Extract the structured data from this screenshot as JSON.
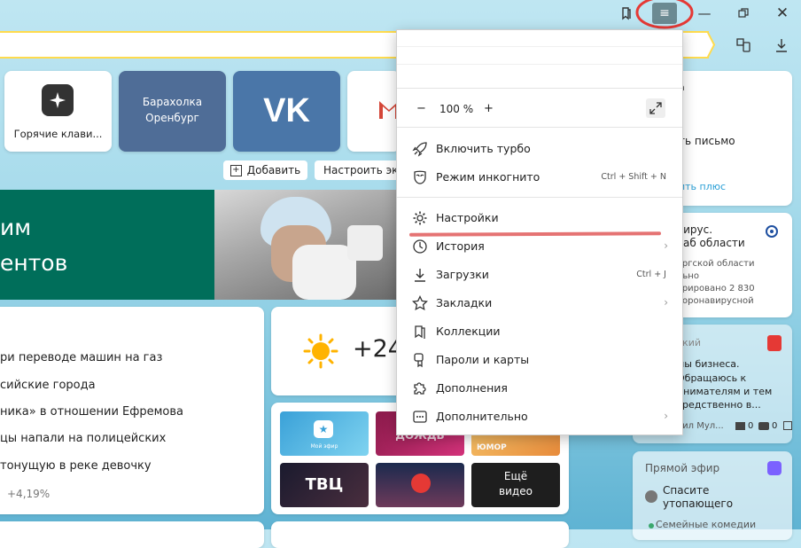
{
  "tiles": [
    {
      "label": "Горячие клави..."
    },
    {
      "line1": "Барахолка",
      "line2": "Оренбург"
    },
    {
      "label": "VK"
    }
  ],
  "actions": {
    "add": "Добавить",
    "customize": "Настроить экр"
  },
  "banner": {
    "line1": "им",
    "line2": "ентов"
  },
  "news": {
    "items": [
      "ри переводе машин на газ",
      "сийские города",
      "ника» в отношении Ефремова",
      "цы напали на полицейских",
      "тонущую в реке девочку"
    ],
    "stock": "+4,19%"
  },
  "weather": {
    "temp": "+24"
  },
  "videos": [
    {
      "caption": "Мой эфир"
    },
    {
      "caption": "ДОЖДЬ"
    },
    {
      "caption": "ЮМОР"
    },
    {
      "caption": "ТВЦ"
    },
    {
      "caption": ""
    },
    {
      "line1": "Ещё",
      "line2": "видео"
    }
  ],
  "right": {
    "mail": {
      "l1": "а",
      "l2": "ть письмо",
      "link": "ить плюс"
    },
    "covid": {
      "l1": "вирус.",
      "l2": "таб области",
      "l3": "ургской области",
      "l4": "льно",
      "l5": "трировано 2 830",
      "l6": "коронавирусной"
    },
    "zen": {
      "l1": "ский",
      "l2": "мы бизнеса.",
      "l3": "Обращаюсь к",
      "l4": "инимателям и тем",
      "l5": "средственно в...",
      "author": "аил Мул...",
      "photos": "0",
      "comments": "0"
    },
    "live": {
      "title": "Прямой эфир",
      "show1": "Спасите",
      "show2": "утопающего",
      "next": "Семейные комедии"
    }
  },
  "menu": {
    "zoom": {
      "minus": "−",
      "value": "100 %",
      "plus": "+"
    },
    "items": [
      {
        "label": "Включить турбо"
      },
      {
        "label": "Режим инкогнито",
        "shortcut": "Ctrl + Shift + N"
      },
      {
        "label": "Настройки"
      },
      {
        "label": "История",
        "arrow": "›"
      },
      {
        "label": "Загрузки",
        "shortcut": "Ctrl + J"
      },
      {
        "label": "Закладки",
        "arrow": "›"
      },
      {
        "label": "Коллекции"
      },
      {
        "label": "Пароли и карты"
      },
      {
        "label": "Дополнения"
      },
      {
        "label": "Дополнительно",
        "arrow": "›"
      }
    ]
  },
  "colors": {
    "accent": "#ffdb4d",
    "annotation": "#e53935",
    "vk": "#4a76a8",
    "banner": "#006e5a"
  }
}
